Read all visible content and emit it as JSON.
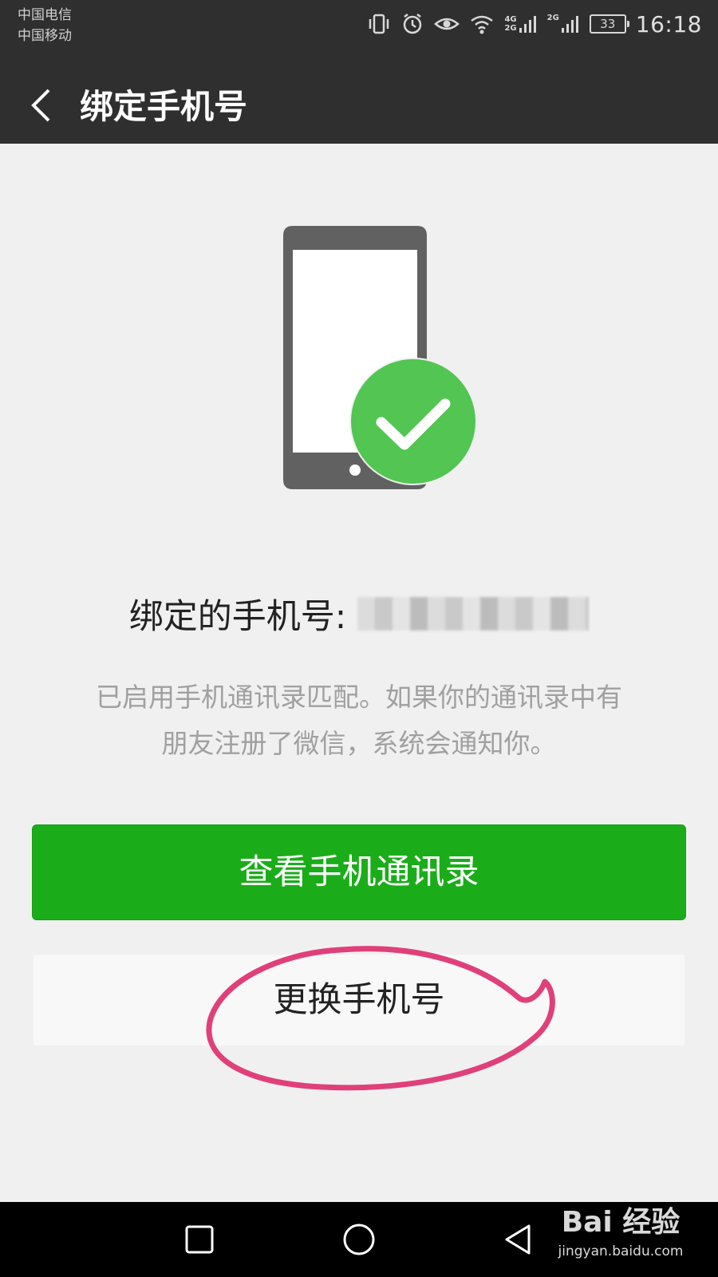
{
  "status_bar": {
    "carrier_1": "中国电信",
    "carrier_2": "中国移动",
    "network_1": "4G",
    "network_1b": "2G",
    "network_2": "2G",
    "battery": "33",
    "time": "16:18",
    "icons": [
      "vibrate-icon",
      "alarm-icon",
      "eye-icon",
      "wifi-icon",
      "signal-icon",
      "signal-icon",
      "battery-icon"
    ]
  },
  "header": {
    "title": "绑定手机号",
    "back_icon": "chevron-left-icon"
  },
  "illustration": {
    "icons": [
      "phone-icon",
      "check-circle-icon"
    ],
    "check_color": "#52c552",
    "phone_color": "#616161"
  },
  "binding": {
    "label": "绑定的手机号:"
  },
  "hint": {
    "line1": "已启用手机通讯录匹配。如果你的通讯录中有",
    "line2": "朋友注册了微信，系统会通知你。"
  },
  "buttons": {
    "view_contacts": "查看手机通讯录",
    "change_phone": "更换手机号"
  },
  "colors": {
    "primary_green": "#1aad19",
    "bar_dark": "#2f2f2f",
    "annotation_pink": "#e0407a"
  },
  "navbar": {
    "icons": [
      "square-icon",
      "circle-icon",
      "triangle-back-icon"
    ]
  },
  "watermark": {
    "brand": "Bai 经验",
    "url": "jingyan.baidu.com"
  }
}
